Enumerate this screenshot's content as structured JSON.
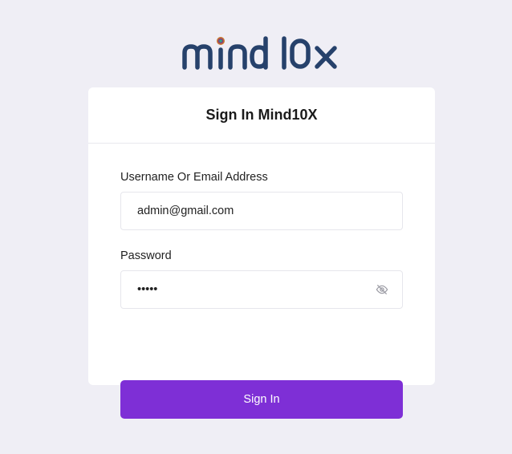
{
  "logo": {
    "text": "mind 10x",
    "colors": {
      "primary": "#26416b",
      "dot_outer": "#c8762f",
      "dot_mid": "#8a3b7a",
      "dot_inner": "#2fa58a"
    }
  },
  "card": {
    "title": "Sign In Mind10X"
  },
  "form": {
    "username_label": "Username Or Email Address",
    "username_value": "admin@gmail.com",
    "password_label": "Password",
    "password_value": "admin",
    "password_toggle_icon": "eye-off-icon",
    "submit_label": "Sign In"
  },
  "colors": {
    "background": "#efeef5",
    "card": "#ffffff",
    "accent": "#7e2fd6"
  }
}
